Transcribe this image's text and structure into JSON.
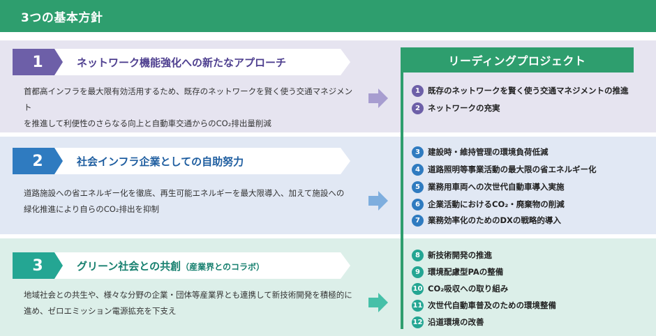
{
  "header": {
    "title": "3つの基本方針"
  },
  "policies": [
    {
      "number": "1",
      "title": "ネットワーク機能強化への新たなアプローチ",
      "subtitle": "",
      "description_lines": [
        "首都高インフラを最大限有効活用するため、既存のネットワークを賢く使う交通マネジメント",
        "を推進して利便性のさらなる向上と自動車交通からのCO₂排出量削減"
      ]
    },
    {
      "number": "2",
      "title": "社会インフラ企業としての自助努力",
      "subtitle": "",
      "description_lines": [
        "道路施設への省エネルギー化を徹底、再生可能エネルギーを最大限導入、加えて施設への",
        "緑化推進により自らのCO₂排出を抑制"
      ]
    },
    {
      "number": "3",
      "title": "グリーン社会との共創",
      "subtitle": "（産業界とのコラボ）",
      "description_lines": [
        "地域社会との共生や、様々な分野の企業・団体等産業界とも連携して新技術開発を積極的に",
        "進め、ゼロエミッション電源拡充を下支え"
      ]
    }
  ],
  "leading_project": {
    "title": "リーディングプロジェクト",
    "items": [
      {
        "num": "1",
        "text": "既存のネットワークを賢く使う交通マネジメントの推進"
      },
      {
        "num": "2",
        "text": "ネットワークの充実"
      },
      {
        "num": "3",
        "text": "建設時・維持管理の環境負荷低減"
      },
      {
        "num": "4",
        "text": "道路照明等事業活動の最大限の省エネルギー化"
      },
      {
        "num": "5",
        "text": "業務用車両への次世代自動車導入実施"
      },
      {
        "num": "6",
        "text": "企業活動におけるCO₂・廃棄物の削減"
      },
      {
        "num": "7",
        "text": "業務効率化のためのDXの戦略的導入"
      },
      {
        "num": "8",
        "text": "新技術開発の推進"
      },
      {
        "num": "9",
        "text": "環境配慮型PAの整備"
      },
      {
        "num": "10",
        "text": "CO₂吸収への取り組み"
      },
      {
        "num": "11",
        "text": "次世代自動車普及のための環境整備"
      },
      {
        "num": "12",
        "text": "沿道環境の改善"
      }
    ]
  },
  "colors": {
    "header_green": "#2e9e6e",
    "policy1_purple": "#6d5fa8",
    "policy2_blue": "#2f7bc0",
    "policy3_teal": "#24a693"
  }
}
